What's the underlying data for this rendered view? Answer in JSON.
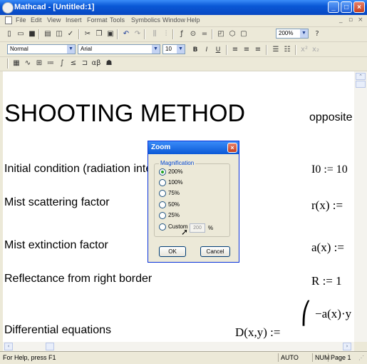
{
  "window": {
    "title": "Mathcad - [Untitled:1]"
  },
  "menu": [
    "File",
    "Edit",
    "View",
    "Insert",
    "Format",
    "Tools",
    "Symbolics",
    "Window",
    "Help"
  ],
  "format_toolbar": {
    "style": "Normal",
    "font": "Arial",
    "size": "10",
    "bold": "B",
    "italic": "I",
    "underline": "U"
  },
  "zoom_combo": "200%",
  "worksheet": {
    "title": "SHOOTING METHOD",
    "title_side": "opposite",
    "rows": [
      {
        "label": "Initial condition (radiation intensity at left",
        "expr": "I0 := 10"
      },
      {
        "label": "Mist scattering factor",
        "expr": "r(x) :="
      },
      {
        "label": "Mist extinction factor",
        "expr": "a(x) :="
      },
      {
        "label": "Reflectance from right border",
        "expr": "R := 1"
      },
      {
        "label": "Differential equations",
        "expr": "D(x,y) :=",
        "matrix_top": "−a(x)·y"
      }
    ]
  },
  "zoom_dialog": {
    "title": "Zoom",
    "group": "Magnification",
    "options": [
      "200%",
      "100%",
      "75%",
      "50%",
      "25%",
      "Custom"
    ],
    "selected": "200%",
    "custom_value": "200",
    "percent": "%",
    "ok": "OK",
    "cancel": "Cancel"
  },
  "status": {
    "help": "For Help, press F1",
    "mode": "AUTO",
    "num": "NUM",
    "page": "Page 1"
  }
}
